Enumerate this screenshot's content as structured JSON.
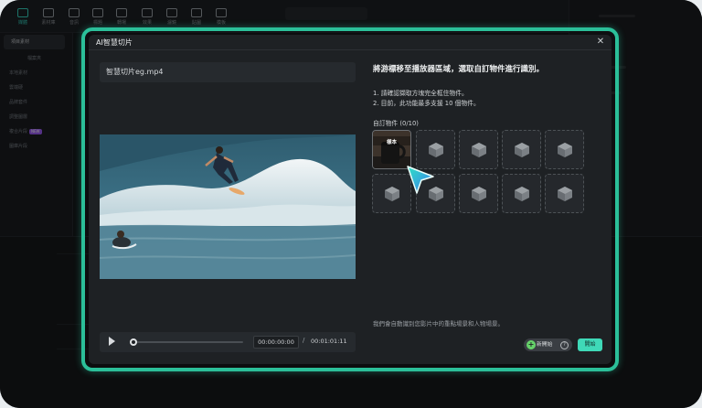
{
  "toolbar": {
    "items": [
      "媒體",
      "素材庫",
      "音訊",
      "標題",
      "轉場",
      "效果",
      "濾鏡",
      "貼圖",
      "模板"
    ]
  },
  "left_panel": {
    "items": [
      "項目素材",
      "檔案夾",
      "本地素材",
      "雲端硬",
      "品牌套件",
      "調整圖層",
      "複合片段",
      "圖庫片段"
    ],
    "badge": "NEW"
  },
  "dialog": {
    "title": "AI智慧切片",
    "close_icon": "close-icon",
    "filename": "智慧切片eg.mp4",
    "heading": "將游標移至播放器區域，選取自訂物件進行識別。",
    "tips": [
      "1. 請確認擷取方塊完全框住物件。",
      "2. 目前，此功能最多支援 10 個物件。"
    ],
    "custom_objects_label": "自訂物件 (0/10)",
    "sample_label": "樣本",
    "slot_icon": "cube-icon",
    "playback": {
      "current_time": "00:00:00:00",
      "separator": "/",
      "total_time": "00:01:01:11"
    },
    "bottom_note": "我們會自動識別您影片中的重點場景和人物場景。",
    "beginner_label": "新開始",
    "start_label": "開始"
  },
  "colors": {
    "accent": "#3fd9b8",
    "glow": "#2bbf99",
    "dialog_bg": "#1e2124"
  }
}
